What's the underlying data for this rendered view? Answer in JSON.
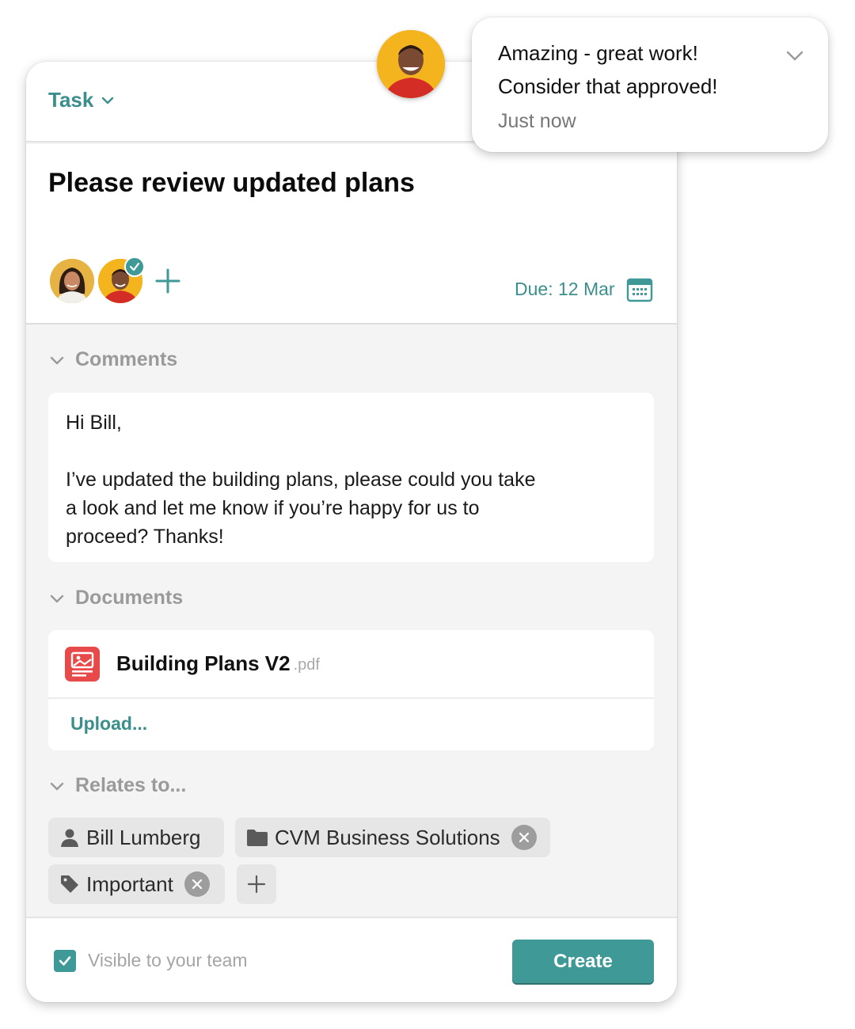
{
  "task": {
    "type_label": "Task",
    "title": "Please review updated plans",
    "due_label": "Due: 12 Mar"
  },
  "sections": {
    "comments": "Comments",
    "documents": "Documents",
    "relates": "Relates to..."
  },
  "comment": {
    "greeting": "Hi Bill,",
    "lines": [
      "I’ve updated the building plans, please could you take",
      "a look and let me know if you’re happy for us to",
      "proceed? Thanks!"
    ]
  },
  "document": {
    "name": "Building Plans V2",
    "ext": ".pdf",
    "upload_label": "Upload..."
  },
  "relates": {
    "person": "Bill Lumberg",
    "company": "CVM Business Solutions",
    "tag": "Important"
  },
  "footer": {
    "visible_label": "Visible to your team",
    "visible_checked": true,
    "create_label": "Create"
  },
  "notification": {
    "message_line1": "Amazing - great work!",
    "message_line2": "Consider that approved!",
    "time": "Just now"
  },
  "colors": {
    "accent": "#3f9a97",
    "accent_text": "#3a8f8c",
    "pdf_red": "#e84a4a",
    "chip_bg": "#e6e6e6",
    "panel_bg": "#f4f4f4"
  },
  "icons": [
    "chevron-down-icon",
    "plus-icon",
    "calendar-icon",
    "pdf-icon",
    "person-icon",
    "folder-icon",
    "tag-icon",
    "close-icon",
    "check-icon"
  ]
}
